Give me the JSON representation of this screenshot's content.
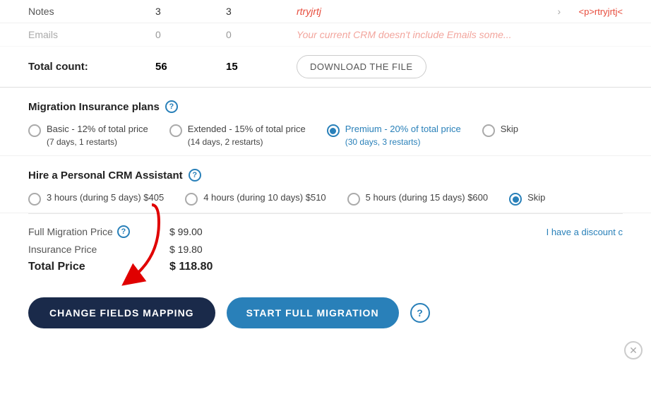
{
  "table": {
    "rows": [
      {
        "label": "Notes",
        "count1": "3",
        "count2": "3",
        "link": "rtryjrtj",
        "arrow": "›",
        "html": "<p>rtryjrtj<"
      },
      {
        "label": "Emails",
        "count1": "0",
        "count2": "0",
        "link": "Your current CRM doesn't include Emails some...",
        "arrow": "",
        "html": ""
      }
    ],
    "total": {
      "label": "Total count:",
      "count1": "56",
      "count2": "15"
    },
    "download_button": "DOWNLOAD THE FILE"
  },
  "insurance": {
    "section_title": "Migration Insurance plans",
    "options": [
      {
        "id": "basic",
        "label": "Basic - 12% of total price",
        "sublabel": "(7 days, 1 restarts)",
        "checked": false
      },
      {
        "id": "extended",
        "label": "Extended - 15% of total price",
        "sublabel": "(14 days, 2 restarts)",
        "checked": false
      },
      {
        "id": "premium",
        "label": "Premium - 20% of total price",
        "sublabel": "(30 days, 3 restarts)",
        "checked": true,
        "highlighted": true
      },
      {
        "id": "skip_insurance",
        "label": "Skip",
        "checked": false
      }
    ]
  },
  "crm_assistant": {
    "section_title": "Hire a Personal CRM Assistant",
    "options": [
      {
        "id": "3hours",
        "label": "3 hours (during 5 days) $405",
        "checked": false
      },
      {
        "id": "4hours",
        "label": "4 hours (during 10 days) $510",
        "checked": false
      },
      {
        "id": "5hours",
        "label": "5 hours (during 15 days) $600",
        "checked": false
      },
      {
        "id": "skip_crm",
        "label": "Skip",
        "checked": true
      }
    ]
  },
  "pricing": {
    "migration_label": "Full Migration Price",
    "migration_value": "$ 99.00",
    "insurance_label": "Insurance Price",
    "insurance_value": "$ 19.80",
    "total_label": "Total Price",
    "total_value": "$ 118.80",
    "discount_link": "I have a discount c"
  },
  "buttons": {
    "change_fields": "CHANGE FIELDS MAPPING",
    "start_migration": "START FULL MIGRATION",
    "help_label": "?"
  }
}
